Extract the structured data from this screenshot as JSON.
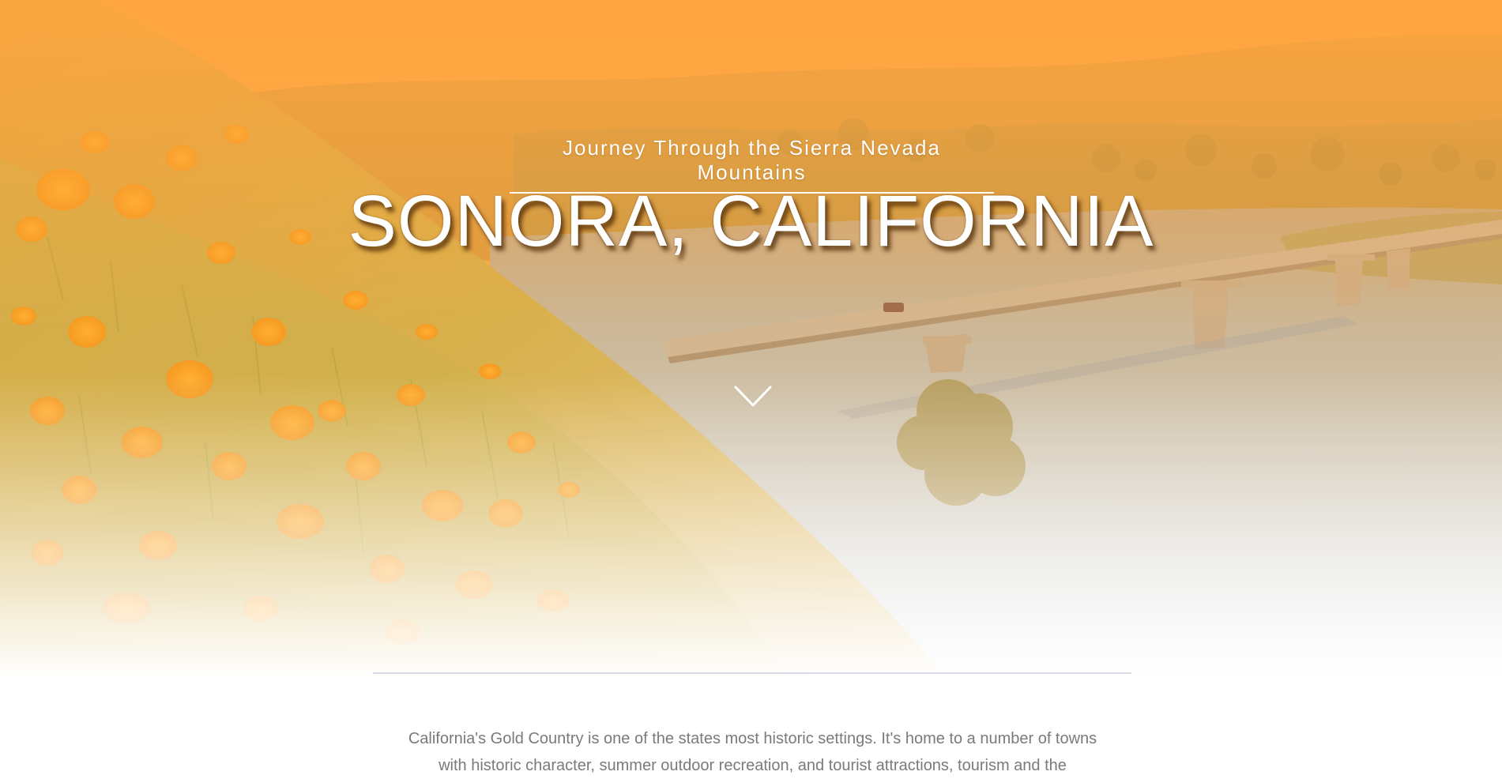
{
  "hero": {
    "eyebrow": "Journey Through the Sierra Nevada Mountains",
    "title": "SONORA, CALIFORNIA",
    "scroll_icon": "chevron-down-icon",
    "overlay_color": "#ffa640"
  },
  "intro": {
    "text": "California's Gold Country is one of the states most historic settings. It's home to a number of towns with historic character, summer outdoor recreation, and tourist attractions, tourism and the"
  },
  "colors": {
    "accent": "#ffa640",
    "divider": "#d9dce8",
    "body_text": "#7a7a7a"
  }
}
